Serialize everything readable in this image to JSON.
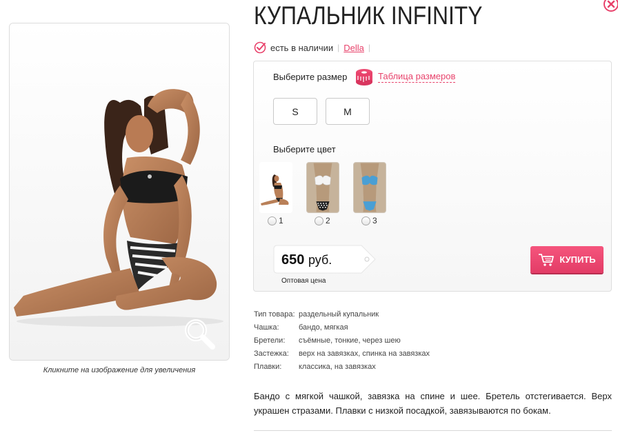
{
  "product": {
    "title": "КУПАЛЬНИК INFINITY",
    "stock_status": "есть в наличии",
    "brand": "Della",
    "image_caption": "Кликните на изображение для увеличения"
  },
  "options": {
    "size_label": "Выберите размер",
    "size_table_link": "Таблица размеров",
    "sizes": [
      "S",
      "M"
    ],
    "color_label": "Выберите цвет",
    "colors": [
      {
        "number": "1",
        "icon": "model-photo"
      },
      {
        "number": "2",
        "icon": "white-bikini-thumb"
      },
      {
        "number": "3",
        "icon": "blue-bikini-thumb"
      }
    ]
  },
  "price": {
    "value": "650",
    "currency": "руб.",
    "note": "Оптовая цена"
  },
  "buy_button": {
    "label": "КУПИТЬ"
  },
  "specs": [
    {
      "key": "Тип товара:",
      "value": "раздельный купальник"
    },
    {
      "key": "Чашка:",
      "value": "бандо, мягкая"
    },
    {
      "key": "Бретели:",
      "value": "съёмные, тонкие, через шею"
    },
    {
      "key": "Застежка:",
      "value": "верх на завязках, спинка на завязках"
    },
    {
      "key": "Плавки:",
      "value": "классика, на завязках"
    }
  ],
  "description": "Бандо с мягкой чашкой, завязка на спине и шее. Бретель отстегивается. Верх украшен стразами. Плавки с низкой посадкой, завязываются по бокам.",
  "colors": {
    "accent": "#e8426b",
    "buy_button": "#f04f76",
    "border": "#dedede"
  },
  "icons": {
    "close": "close-icon",
    "in_stock": "check-circle-icon",
    "size_table": "measuring-tape-icon",
    "zoom": "magnifier-icon",
    "cart": "cart-icon"
  }
}
